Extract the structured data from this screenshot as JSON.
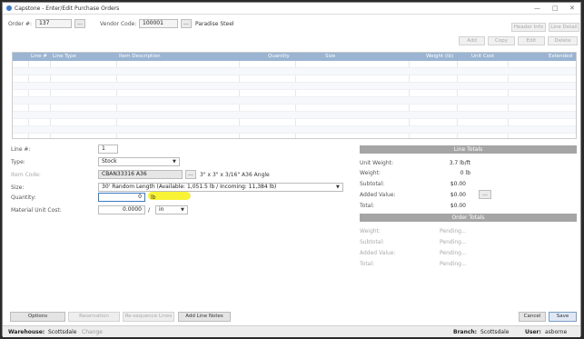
{
  "window": {
    "title": "Capstone - Enter/Edit Purchase Orders",
    "controls": [
      "—",
      "□",
      "✕"
    ]
  },
  "header": {
    "order_label": "Order #:",
    "order_value": "137",
    "vendor_label": "Vendor Code:",
    "vendor_value": "100001",
    "vendor_name": "Paradise Steel",
    "lookup": "...",
    "header_info": "Header Info",
    "line_detail": "Line Detail"
  },
  "toolbar": {
    "add": "Add",
    "copy": "Copy",
    "edit": "Edit",
    "delete": "Delete"
  },
  "grid": {
    "columns": [
      "Line #",
      "Line Type",
      "Item Description",
      "Quantity",
      "Size",
      "Weight (lb)",
      "Unit Cost",
      "Extended"
    ]
  },
  "form": {
    "line_label": "Line #:",
    "line_value": "1",
    "type_label": "Type:",
    "type_value": "Stock",
    "item_label": "Item Code:",
    "item_value": "CBAN33316 A36",
    "item_desc": "3\" x 3\" x 3/16\" A36 Angle",
    "size_label": "Size:",
    "size_value": "30' Random Length  (Available: 1,051.5 lb  /  Incoming: 11,384 lb)",
    "qty_label": "Quantity:",
    "qty_value": "0",
    "qty_unit": "lb",
    "cost_label": "Material Unit Cost:",
    "cost_value": "0.0000",
    "cost_sep": "/",
    "cost_unit": "in",
    "dropdown": "▼"
  },
  "line_totals": {
    "header": "Line Totals",
    "unit_weight_label": "Unit Weight:",
    "unit_weight_value": "3.7 lb/ft",
    "weight_label": "Weight:",
    "weight_value": "0 lb",
    "subtotal_label": "Subtotal:",
    "subtotal_value": "$0.00",
    "added_label": "Added Value:",
    "added_value": "$0.00",
    "total_label": "Total:",
    "total_value": "$0.00"
  },
  "order_totals": {
    "header": "Order Totals",
    "weight_label": "Weight:",
    "subtotal_label": "Subtotal:",
    "added_label": "Added Value:",
    "total_label": "Total:",
    "pending": "Pending..."
  },
  "buttons": {
    "options": "Options",
    "reservation": "Reservation",
    "resequence": "Re-sequence Lines",
    "add_line_notes": "Add Line Notes",
    "cancel": "Cancel",
    "save": "Save"
  },
  "status": {
    "warehouse_label": "Warehouse:",
    "warehouse_value": "Scottsdale",
    "change": "Change",
    "branch_label": "Branch:",
    "branch_value": "Scottsdale",
    "user_label": "User:",
    "user_value": "asborne"
  },
  "colors": {
    "grid_header": "#9ab4d2",
    "panel_header": "#a5a5a5",
    "highlight": "#f8f22a"
  }
}
